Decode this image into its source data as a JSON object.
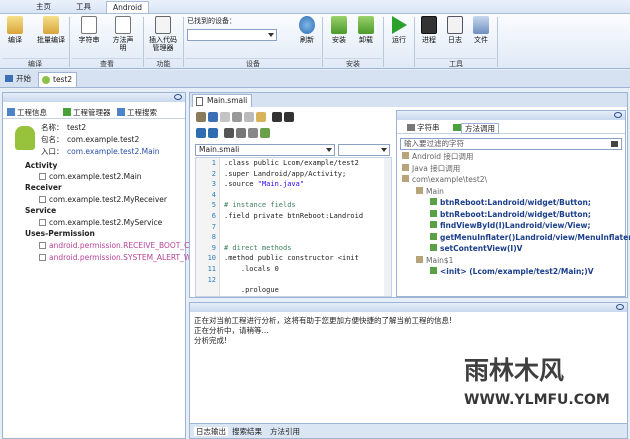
{
  "menu_tabs": [
    "主页",
    "工具",
    "Android"
  ],
  "ribbon": {
    "btn_compile": "编译",
    "btn_batch_compile": "批量编译",
    "grp_compile": "编译",
    "btn_strings": "字符串",
    "btn_method_decl": "方法声明",
    "grp_view": "查看",
    "btn_insert_code": "插入代码管理器",
    "grp_function": "功能",
    "device_label": "已找到的设备：",
    "device_value": "",
    "btn_refresh": "刷新",
    "grp_device": "设备",
    "btn_install": "安装",
    "btn_uninstall": "卸载",
    "grp_install": "安装",
    "btn_run": "运行",
    "btn_process": "进程",
    "btn_log": "日志",
    "btn_file": "文件",
    "grp_tools": "工具"
  },
  "doc_tabs": [
    "开始",
    "test2"
  ],
  "left_panel": {
    "tabs": [
      "工程信息",
      "工程管理器",
      "工程搜索"
    ],
    "name_label": "名称：",
    "name_value": "test2",
    "package_label": "包名：",
    "package_value": "com.example.test2",
    "entry_label": "入口：",
    "entry_value": "com.example.test2.Main",
    "sections": [
      {
        "title": "Activity",
        "items": [
          "com.example.test2.Main"
        ]
      },
      {
        "title": "Receiver",
        "items": [
          "com.example.test2.MyReceiver"
        ]
      },
      {
        "title": "Service",
        "items": [
          "com.example.test2.MyService"
        ]
      },
      {
        "title": "Uses-Permission",
        "items": [
          "android.permission.RECEIVE_BOOT_C",
          "android.permission.SYSTEM_ALERT_W"
        ]
      }
    ]
  },
  "editor": {
    "tab": "Main.smali",
    "file_select": "Main.smali",
    "member_select": "",
    "line_numbers": [
      "1",
      "2",
      "3",
      "4",
      "5",
      "6",
      "7",
      "8",
      "9",
      "10",
      "11",
      "12"
    ],
    "code": [
      {
        "p": [
          {
            "t": ".class public Lcom/example/test2",
            "c": ""
          }
        ]
      },
      {
        "p": [
          {
            "t": ".super Landroid/app/Activity;",
            "c": ""
          }
        ]
      },
      {
        "p": [
          {
            "t": ".source ",
            "c": ""
          },
          {
            "t": "\"Main.java\"",
            "c": "str"
          }
        ]
      },
      {
        "p": []
      },
      {
        "p": [
          {
            "t": "# instance fields",
            "c": "cm"
          }
        ]
      },
      {
        "p": [
          {
            "t": ".field private btnReboot:Landroid",
            "c": ""
          }
        ]
      },
      {
        "p": []
      },
      {
        "p": []
      },
      {
        "p": [
          {
            "t": "# direct methods",
            "c": "cm"
          }
        ]
      },
      {
        "p": [
          {
            "t": ".method public constructor <init",
            "c": ""
          }
        ]
      },
      {
        "p": [
          {
            "t": "    .locals 0",
            "c": ""
          }
        ]
      },
      {
        "p": [
          {
            "t": "",
            "c": ""
          }
        ]
      },
      {
        "p": [
          {
            "t": "    .prologue",
            "c": ""
          }
        ]
      }
    ]
  },
  "right_panel": {
    "tabs": [
      "字符串",
      "方法调用"
    ],
    "filter_placeholder": "输入要过滤的字符",
    "tree": [
      {
        "text": "Android 接口调用",
        "cls": "gray",
        "level": 0
      },
      {
        "text": "Java 接口调用",
        "cls": "gray",
        "level": 0
      },
      {
        "text": "com\\example\\test2\\",
        "cls": "gray",
        "level": 0
      },
      {
        "text": "Main",
        "cls": "gray",
        "level": 1
      },
      {
        "text": "btnReboot:Landroid/widget/Button;",
        "cls": "bold",
        "level": 2
      },
      {
        "text": "btnReboot:Landroid/widget/Button;",
        "cls": "bold",
        "level": 2
      },
      {
        "text": "findViewById(I)Landroid/view/View;",
        "cls": "bold",
        "level": 2
      },
      {
        "text": "getMenuInflater()Landroid/view/MenuInflater;",
        "cls": "bold",
        "level": 2
      },
      {
        "text": "setContentView(I)V",
        "cls": "bold",
        "level": 2
      },
      {
        "text": "Main$1",
        "cls": "gray",
        "level": 1
      },
      {
        "text": "<init> (Lcom/example/test2/Main;)V",
        "cls": "bold",
        "level": 2
      }
    ]
  },
  "log": {
    "lines": [
      "正在对当前工程进行分析，这将有助于您更加方便快捷的了解当前工程的信息!",
      "正在分析中，请稍等...",
      "分析完成!"
    ],
    "tabs": [
      "日志输出",
      "搜索结果",
      "方法引用"
    ]
  },
  "watermark": {
    "cn": "雨林木风",
    "url": "WWW.YLMFU.COM"
  }
}
